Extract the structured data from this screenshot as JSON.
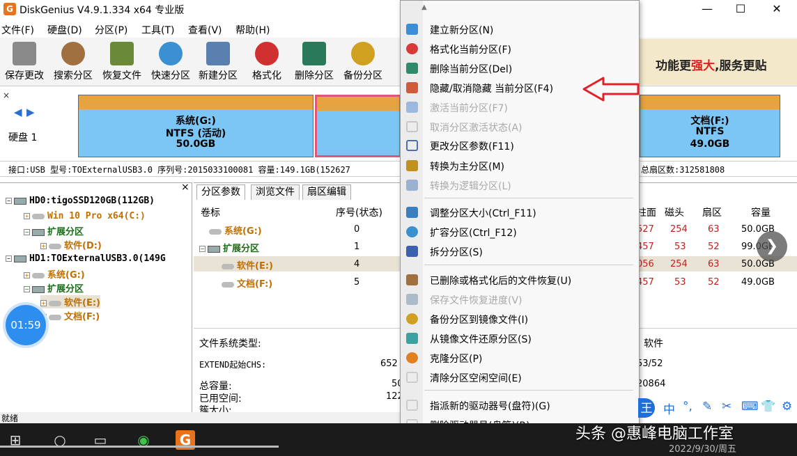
{
  "window": {
    "icon_glyph": "G",
    "title": "DiskGenius V4.9.1.334 x64 专业版",
    "minimize": "—",
    "maximize": "☐",
    "close": "✕"
  },
  "menubar": [
    "文件(F)",
    "硬盘(D)",
    "分区(P)",
    "工具(T)",
    "查看(V)",
    "帮助(H)"
  ],
  "toolbar": {
    "items": [
      {
        "label": "保存更改",
        "color": "#8a8a8a"
      },
      {
        "label": "搜索分区",
        "color": "#a07040"
      },
      {
        "label": "恢复文件",
        "color": "#6a8a3a"
      },
      {
        "label": "快速分区",
        "color": "#3a90d0"
      },
      {
        "label": "新建分区",
        "color": "#5a80b0"
      },
      {
        "label": "格式化",
        "color": "#d03030"
      },
      {
        "label": "删除分区",
        "color": "#2a7a5a"
      },
      {
        "label": "备份分区",
        "color": "#d0a020"
      }
    ],
    "banner_prefix": "功能更",
    "banner_highlight": "强大",
    "banner_suffix": ",服务更贴"
  },
  "disk": {
    "nav_prev": "◀",
    "nav_next": "▶",
    "label": "硬盘 1",
    "partitions": [
      {
        "name": "系统(G:)",
        "fs": "NTFS (活动)",
        "size": "50.0GB"
      },
      {
        "name": "文档(F:)",
        "fs": "NTFS",
        "size": "49.0GB"
      }
    ],
    "info_left": "接口:USB  型号:TOExternalUSB3.0  序列号:2015033100081  容量:149.1GB(152627",
    "info_right": "总扇区数:312581808"
  },
  "tree": {
    "close": "×",
    "nodes": [
      {
        "text": "HD0:tigoSSD120GB(112GB)"
      },
      {
        "text": "Win 10 Pro x64(C:)"
      },
      {
        "text": "扩展分区"
      },
      {
        "text": "软件(D:)"
      },
      {
        "text": "HD1:TOExternalUSB3.0(149G"
      },
      {
        "text": "系统(G:)"
      },
      {
        "text": "扩展分区"
      },
      {
        "text": "软件(E:)"
      },
      {
        "text": "文档(F:)"
      }
    ]
  },
  "timer": "01:59",
  "panel": {
    "tabs": [
      "分区参数",
      "浏览文件",
      "扇区编辑"
    ],
    "headers": {
      "label": "卷标",
      "index": "序号(状态)",
      "cyl": "柱面",
      "head": "磁头",
      "sector": "扇区",
      "capacity": "容量"
    },
    "rows": [
      {
        "label": "系统(G:)",
        "index": "0",
        "cyl": "527",
        "head": "254",
        "sector": "63",
        "capacity": "50.0GB"
      },
      {
        "label": "扩展分区",
        "index": "1",
        "cyl": "457",
        "head": "53",
        "sector": "52",
        "capacity": "99.0GB"
      },
      {
        "label": "软件(E:)",
        "index": "4",
        "cyl": "056",
        "head": "254",
        "sector": "63",
        "capacity": "50.0GB"
      },
      {
        "label": "文档(F:)",
        "index": "5",
        "cyl": "457",
        "head": "53",
        "sector": "52",
        "capacity": "49.0GB"
      }
    ],
    "fs_type_label": "文件系统类型:",
    "fs_type_right": "软件",
    "chs_label": "EXTEND起始CHS:",
    "chs_mid": "652",
    "chs_right": "53/52",
    "total_label": "总容量:",
    "total_mid": "50",
    "total_right": "20864",
    "used_label": "已用空间:",
    "used_mid": "122",
    "cluster_label": "簇大小:",
    "status": "就绪"
  },
  "context_menu": {
    "scroll_up": "▲",
    "scroll_down": "▼",
    "items": [
      {
        "label": "建立新分区(N)",
        "enabled": true,
        "color": "#3a8ed6"
      },
      {
        "label": "格式化当前分区(F)",
        "enabled": true,
        "color": "#d83a3a"
      },
      {
        "label": "删除当前分区(Del)",
        "enabled": true,
        "color": "#2e8a6a"
      },
      {
        "label": "隐藏/取消隐藏 当前分区(F4)",
        "enabled": true,
        "color": "#d05a3a"
      },
      {
        "label": "激活当前分区(F7)",
        "enabled": false,
        "color": "#3a7ad0"
      },
      {
        "label": "取消分区激活状态(A)",
        "enabled": false,
        "color": "#999999"
      },
      {
        "label": "更改分区参数(F11)",
        "enabled": true,
        "color": "#4a70b0"
      },
      {
        "label": "转换为主分区(M)",
        "enabled": true,
        "color": "#c09020"
      },
      {
        "label": "转换为逻辑分区(L)",
        "enabled": false,
        "color": "#3a6ab0"
      },
      {
        "label": "调整分区大小(Ctrl_F11)",
        "enabled": true,
        "color": "#3a80c0"
      },
      {
        "label": "扩容分区(Ctrl_F12)",
        "enabled": true,
        "color": "#3a90d0"
      },
      {
        "label": "拆分分区(S)",
        "enabled": true,
        "color": "#3a60b0"
      },
      {
        "label": "已删除或格式化后的文件恢复(U)",
        "enabled": true,
        "color": "#a07040"
      },
      {
        "label": "保存文件恢复进度(V)",
        "enabled": false,
        "color": "#6080a0"
      },
      {
        "label": "备份分区到镜像文件(I)",
        "enabled": true,
        "color": "#d0a020"
      },
      {
        "label": "从镜像文件还原分区(S)",
        "enabled": true,
        "color": "#3aa0a0"
      },
      {
        "label": "克隆分区(P)",
        "enabled": true,
        "color": "#e08020"
      },
      {
        "label": "清除分区空闲空间(E)",
        "enabled": true,
        "color": "#cccccc"
      },
      {
        "label": "指派新的驱动器号(盘符)(G)",
        "enabled": true,
        "color": "#cccccc"
      },
      {
        "label": "删除驱动器号(盘符)(R)",
        "enabled": true,
        "color": "#cccccc"
      }
    ]
  },
  "ime": [
    "中",
    "°,",
    "✎",
    "✂",
    "⌨",
    "👕",
    "⚙"
  ],
  "ime_left": "王",
  "next_btn": "❯",
  "taskbar": {
    "start": "⊞",
    "search": "○",
    "taskview": "▭",
    "wechat": "◉",
    "diskgenius": "G",
    "watermark": "头条 @惠峰电脑工作室",
    "date": "2022/9/30/周五"
  }
}
